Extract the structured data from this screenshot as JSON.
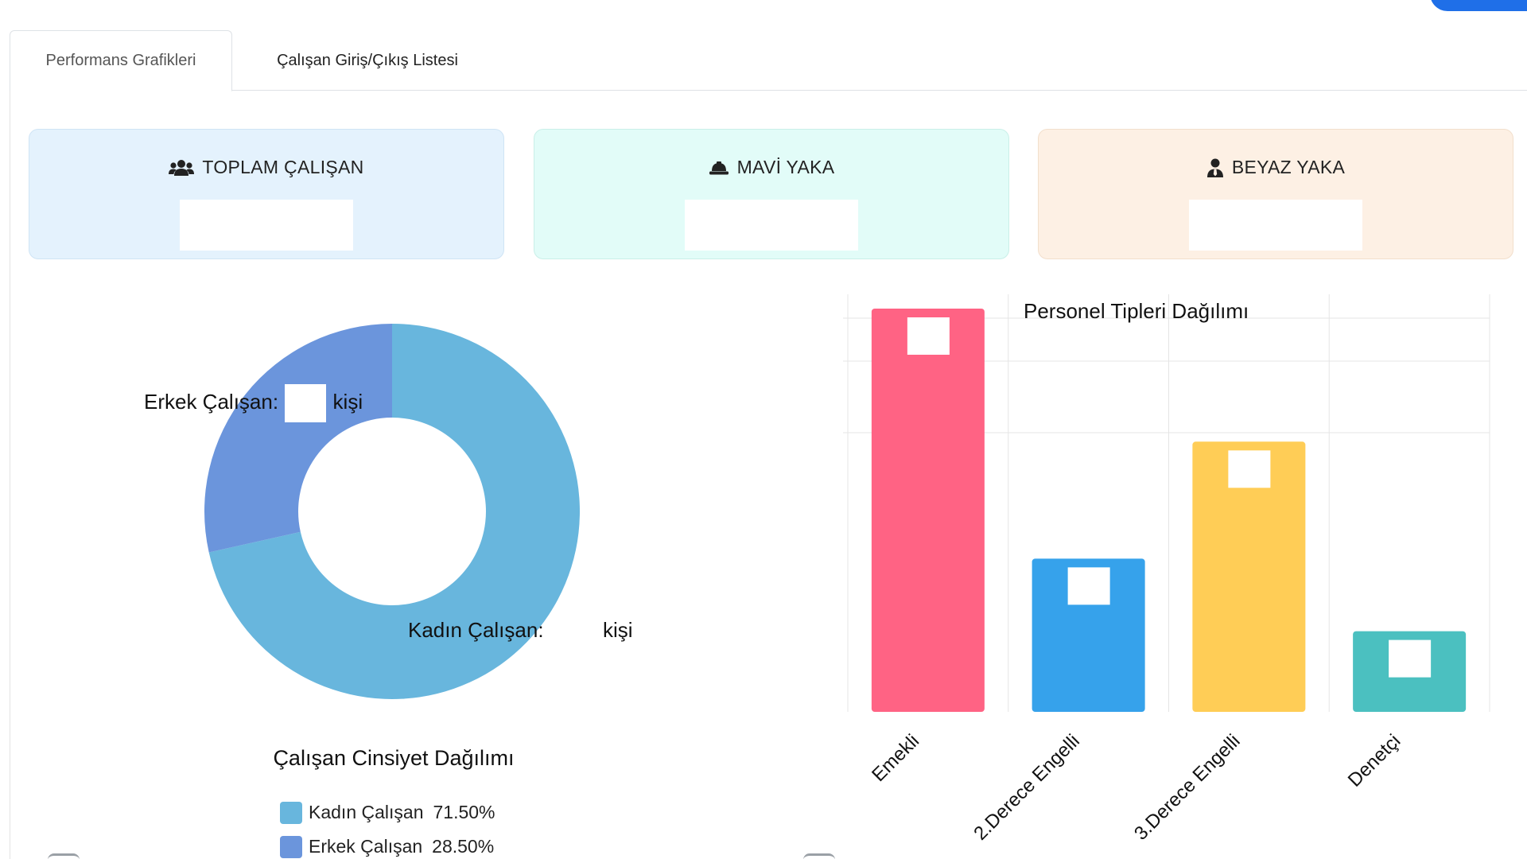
{
  "tabs": [
    {
      "label": "Performans Grafikleri",
      "active": true
    },
    {
      "label": "Çalışan Giriş/Çıkış Listesi",
      "active": false
    }
  ],
  "stats": {
    "total": {
      "label": "TOPLAM ÇALIŞAN",
      "icon": "users-icon",
      "value": ""
    },
    "blue_collar": {
      "label": "MAVİ YAKA",
      "icon": "hard-hat-icon",
      "value": ""
    },
    "white_collar": {
      "label": "BEYAZ YAKA",
      "icon": "user-tie-icon",
      "value": ""
    }
  },
  "gender_chart": {
    "title": "Çalışan Cinsiyet Dağılımı",
    "male_label": "Erkek Çalışan:",
    "female_label": "Kadın Çalışan:",
    "unit": "kişi",
    "legend": [
      {
        "name": "Kadın Çalışan",
        "pct": "71.50%",
        "color": "#68b6dd"
      },
      {
        "name": "Erkek Çalışan",
        "pct": "28.50%",
        "color": "#6b95dc"
      }
    ]
  },
  "chart_data": [
    {
      "type": "pie",
      "title": "Çalışan Cinsiyet Dağılımı",
      "donut": true,
      "slices": [
        {
          "name": "Kadın Çalışan",
          "value": 71.5,
          "color": "#68b6dd"
        },
        {
          "name": "Erkek Çalışan",
          "value": 28.5,
          "color": "#6b95dc"
        }
      ],
      "legend": "bottom"
    },
    {
      "type": "bar",
      "title": "Personel Tipleri Dağılımı",
      "categories": [
        "Emekli",
        "2.Derece Engelli",
        "3.Derece Engelli",
        "Denetçi"
      ],
      "values": [
        100,
        38,
        67,
        20
      ],
      "colors": [
        "#ff6384",
        "#36a2eb",
        "#ffcd56",
        "#4bc0c0"
      ],
      "grid": true
    }
  ]
}
